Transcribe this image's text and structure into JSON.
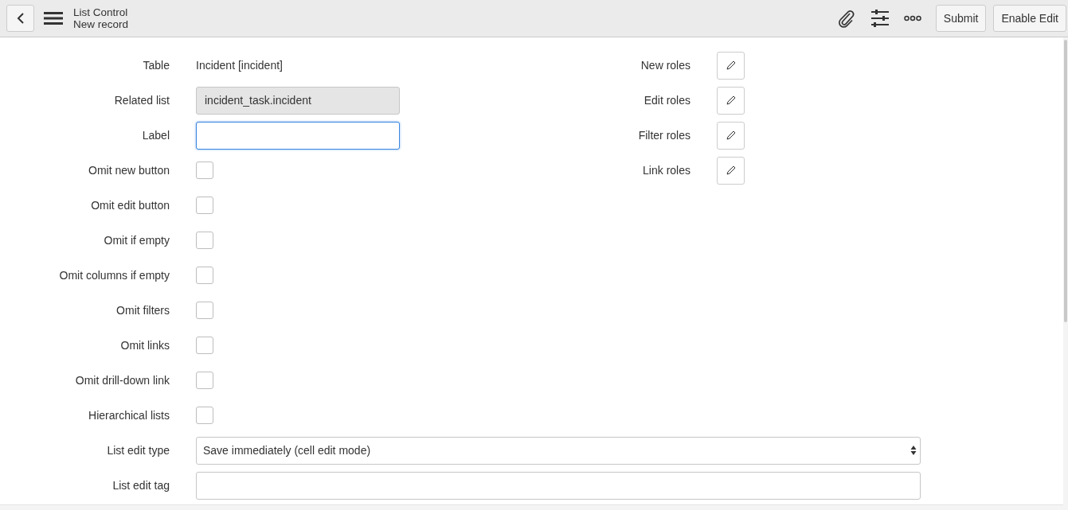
{
  "header": {
    "title": "List Control",
    "subtitle": "New record",
    "buttons": [
      {
        "label": "Submit"
      },
      {
        "label": "Enable Edit"
      }
    ]
  },
  "fields": [
    {
      "kind": "text",
      "label": "Table",
      "value": "Incident [incident]"
    },
    {
      "kind": "readonly",
      "label": "Related list",
      "value": "incident_task.incident"
    },
    {
      "kind": "input",
      "label": "Label",
      "focused": true
    },
    {
      "kind": "checkbox",
      "label": "Omit new button",
      "checked": false
    },
    {
      "kind": "checkbox",
      "label": "Omit edit button",
      "checked": false
    },
    {
      "kind": "checkbox",
      "label": "Omit if empty",
      "checked": false
    },
    {
      "kind": "checkbox",
      "label": "Omit columns if empty",
      "checked": false
    },
    {
      "kind": "checkbox",
      "label": "Omit filters",
      "checked": false
    },
    {
      "kind": "checkbox",
      "label": "Omit links",
      "checked": false
    },
    {
      "kind": "checkbox",
      "label": "Omit drill-down link",
      "checked": false
    },
    {
      "kind": "checkbox",
      "label": "Hierarchical lists",
      "checked": false
    }
  ],
  "roles": [
    {
      "label": "New roles"
    },
    {
      "label": "Edit roles"
    },
    {
      "label": "Filter roles"
    },
    {
      "label": "Link roles"
    }
  ],
  "wide_fields": [
    {
      "kind": "select",
      "label": "List edit type",
      "value": "Save immediately (cell edit mode)"
    },
    {
      "kind": "input",
      "label": "List edit tag",
      "focused": false
    }
  ]
}
